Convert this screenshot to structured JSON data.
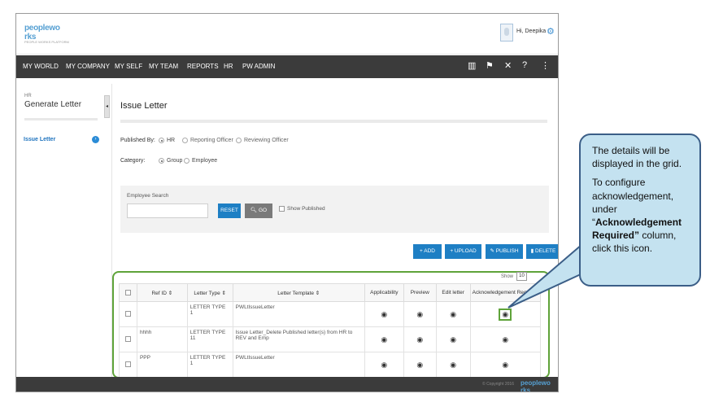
{
  "header": {
    "logo_text": "peoplewo rks",
    "logo_subtext": "PEOPLE WORKS PLATFORM",
    "greeting": "Hi, Deepika"
  },
  "nav": {
    "items": [
      "MY WORLD",
      "MY COMPANY",
      "MY SELF",
      "MY TEAM",
      "REPORTS",
      "HR",
      "PW ADMIN"
    ],
    "tools": [
      "book-icon",
      "flag-icon",
      "tools-icon",
      "help-icon",
      "more-icon"
    ]
  },
  "left_panel": {
    "section": "HR",
    "title": "Generate Letter",
    "item": "Issue Letter"
  },
  "main": {
    "title": "Issue Letter",
    "published_by_label": "Published By:",
    "published_by_options": [
      {
        "label": "HR",
        "selected": true
      },
      {
        "label": "Reporting Officer",
        "selected": false
      },
      {
        "label": "Reviewing Officer",
        "selected": false
      }
    ],
    "category_label": "Category:",
    "category_options": [
      {
        "label": "Group",
        "selected": true
      },
      {
        "label": "Employee",
        "selected": false
      }
    ],
    "search": {
      "label": "Employee Search",
      "value": "",
      "reset": "RESET",
      "go": "GO",
      "show_published": "Show Published"
    },
    "actions": {
      "add": "+ ADD",
      "upload": "+ UPLOAD",
      "publish": "PUBLISH",
      "delete": "DELETE"
    },
    "grid": {
      "show_label": "Show",
      "page_size": "10",
      "columns": [
        "Ref ID ⇕",
        "Letter Type ⇕",
        "Letter Template ⇕",
        "Applicability",
        "Preview",
        "Edit letter",
        "Acknowledgement Required"
      ],
      "rows": [
        {
          "ref_id": "",
          "letter_type": "LETTER TYPE 1",
          "template": "PWLtIssueLetter"
        },
        {
          "ref_id": "hhhh",
          "letter_type": "LETTER TYPE 11",
          "template": "Issue Letter_Delete Published letter(s) from HR to REV and Emp"
        },
        {
          "ref_id": "PPP",
          "letter_type": "LETTER TYPE 1",
          "template": "PWLtIssueLetter"
        }
      ]
    }
  },
  "footer": {
    "copyright": "© Copyright 2016",
    "logo": "peoplewo rks"
  },
  "callout": {
    "line1": "The details will be displayed in the grid.",
    "line2_pre": "To configure acknowledgement, under “",
    "line2_bold": "Acknowledgement Required”",
    "line2_post": " column, click this icon."
  }
}
